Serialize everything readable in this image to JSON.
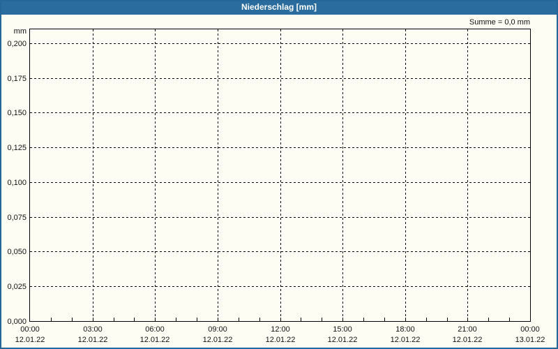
{
  "chart_data": {
    "type": "bar",
    "title": "Niederschlag [mm]",
    "unit_label": "mm",
    "summary_label": "Summe = 0,0 mm",
    "sum_mm": 0.0,
    "series": [
      {
        "name": "Niederschlag",
        "values": []
      }
    ],
    "y_ticks": [
      {
        "label": "0,000",
        "value": 0.0
      },
      {
        "label": "0,025",
        "value": 0.025
      },
      {
        "label": "0,050",
        "value": 0.05
      },
      {
        "label": "0,075",
        "value": 0.075
      },
      {
        "label": "0,100",
        "value": 0.1
      },
      {
        "label": "0,125",
        "value": 0.125
      },
      {
        "label": "0,150",
        "value": 0.15
      },
      {
        "label": "0,175",
        "value": 0.175
      },
      {
        "label": "0,200",
        "value": 0.2
      }
    ],
    "ylim": [
      0,
      0.21
    ],
    "xlim_hours": [
      0,
      24
    ],
    "x_major_ticks": [
      {
        "hour": 0,
        "time": "00:00",
        "date": "12.01.22"
      },
      {
        "hour": 3,
        "time": "03:00",
        "date": "12.01.22"
      },
      {
        "hour": 6,
        "time": "06:00",
        "date": "12.01.22"
      },
      {
        "hour": 9,
        "time": "09:00",
        "date": "12.01.22"
      },
      {
        "hour": 12,
        "time": "12:00",
        "date": "12.01.22"
      },
      {
        "hour": 15,
        "time": "15:00",
        "date": "12.01.22"
      },
      {
        "hour": 18,
        "time": "18:00",
        "date": "12.01.22"
      },
      {
        "hour": 21,
        "time": "21:00",
        "date": "12.01.22"
      },
      {
        "hour": 24,
        "time": "00:00",
        "date": "13.01.22"
      }
    ],
    "x_minor_tick_interval_hours": 1,
    "grid": "dashed",
    "legend": "none",
    "colors": {
      "titlebar": "#2a6c9e",
      "window_border": "#26679a",
      "background": "#fdfdf4",
      "axis": "#000000",
      "text": "#111111",
      "title_text": "#ffffff"
    }
  }
}
